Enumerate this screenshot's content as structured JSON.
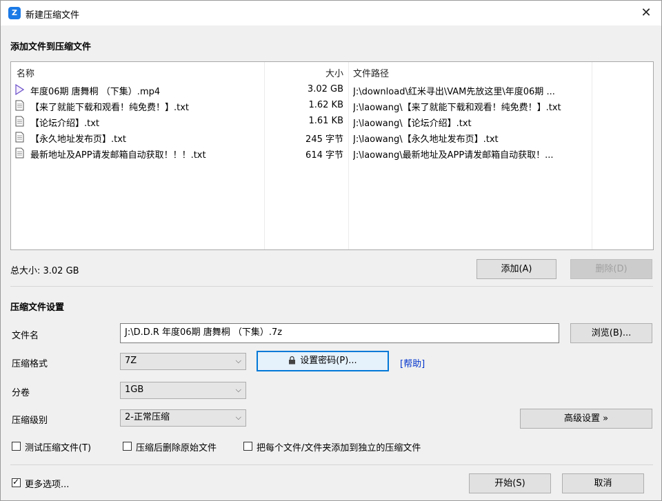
{
  "window": {
    "title": "新建压缩文件",
    "close_glyph": "✕"
  },
  "files_section": {
    "heading": "添加文件到压缩文件",
    "columns": {
      "name": "名称",
      "size": "大小",
      "path": "文件路径"
    },
    "files": [
      {
        "icon": "video-file-icon",
        "name": "年度06期 唐舞桐 （下集）.mp4",
        "size": "3.02 GB",
        "path": "J:\\download\\红米寻出\\VAM先放这里\\年度06期 ..."
      },
      {
        "icon": "text-file-icon",
        "name": "【来了就能下载和观看！纯免费！】.txt",
        "size": "1.62 KB",
        "path": "J:\\laowang\\【来了就能下载和观看！纯免费！】.txt"
      },
      {
        "icon": "text-file-icon",
        "name": "【论坛介绍】.txt",
        "size": "1.61 KB",
        "path": "J:\\laowang\\【论坛介绍】.txt"
      },
      {
        "icon": "text-file-icon",
        "name": "【永久地址发布页】.txt",
        "size": "245 字节",
        "path": "J:\\laowang\\【永久地址发布页】.txt"
      },
      {
        "icon": "text-file-icon",
        "name": "最新地址及APP请发邮箱自动获取！！！.txt",
        "size": "614 字节",
        "path": "J:\\laowang\\最新地址及APP请发邮箱自动获取！..."
      }
    ],
    "total_size": "总大小: 3.02 GB",
    "add_button": "添加(A)",
    "delete_button": "删除(D)"
  },
  "settings": {
    "heading": "压缩文件设置",
    "filename_label": "文件名",
    "filename_value": "J:\\D.D.R 年度06期 唐舞桐 （下集）.7z",
    "browse_button": "浏览(B)...",
    "format_label": "压缩格式",
    "format_value": "7Z",
    "password_button": "设置密码(P)...",
    "help_link": "[帮助]",
    "volume_label": "分卷",
    "volume_value": "1GB",
    "level_label": "压缩级别",
    "level_value": "2-正常压缩",
    "advanced_button": "高级设置 »",
    "checkboxes": [
      {
        "label": "测试压缩文件(T)",
        "checked": false
      },
      {
        "label": "压缩后删除原始文件",
        "checked": false
      },
      {
        "label": "把每个文件/文件夹添加到独立的压缩文件",
        "checked": false
      }
    ]
  },
  "footer": {
    "more_options": {
      "label": "更多选项...",
      "checked": true
    },
    "start_button": "开始(S)",
    "cancel_button": "取消"
  }
}
